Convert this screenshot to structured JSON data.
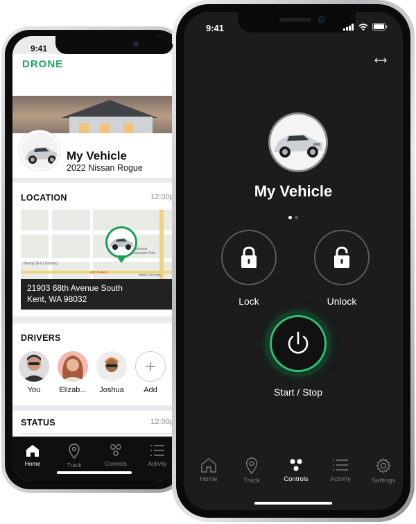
{
  "back_phone": {
    "status_time": "9:41",
    "brand": "DRONE",
    "vehicle": {
      "name": "My Vehicle",
      "model": "2022 Nissan Rogue"
    },
    "location": {
      "title": "LOCATION",
      "time": "12:00pm",
      "address_line1": "21903 68th Avenue South",
      "address_line2": "Kent, WA 98032",
      "map_labels": [
        "Boeing 18-61 Building",
        "Alto Bakery",
        "Northwest Corporate Park",
        "WireCo Foods"
      ]
    },
    "drivers": {
      "title": "DRIVERS",
      "items": [
        {
          "name": "You"
        },
        {
          "name": "Elizab..."
        },
        {
          "name": "Joshua"
        },
        {
          "name": "Add"
        }
      ]
    },
    "status": {
      "title": "STATUS",
      "time": "12:00pm"
    },
    "tabs": [
      {
        "label": "Home",
        "icon": "home-icon",
        "active": true
      },
      {
        "label": "Track",
        "icon": "map-pin-icon",
        "active": false
      },
      {
        "label": "Controls",
        "icon": "controls-icon",
        "active": false
      },
      {
        "label": "Activity",
        "icon": "list-icon",
        "active": false
      }
    ]
  },
  "front_phone": {
    "status_time": "9:41",
    "vehicle_name": "My Vehicle",
    "page_dots": {
      "count": 2,
      "active": 0
    },
    "lock_label": "Lock",
    "unlock_label": "Unlock",
    "start_stop_label": "Start / Stop",
    "tabs": [
      {
        "label": "Home",
        "icon": "home-icon",
        "active": false
      },
      {
        "label": "Track",
        "icon": "map-pin-icon",
        "active": false
      },
      {
        "label": "Controls",
        "icon": "controls-icon",
        "active": true
      },
      {
        "label": "Activity",
        "icon": "list-icon",
        "active": false
      },
      {
        "label": "Settings",
        "icon": "gear-icon",
        "active": false
      }
    ]
  },
  "colors": {
    "brand_green": "#1fa463",
    "power_ring": "#2fbf73",
    "dark_bg": "#1c1c1c"
  }
}
